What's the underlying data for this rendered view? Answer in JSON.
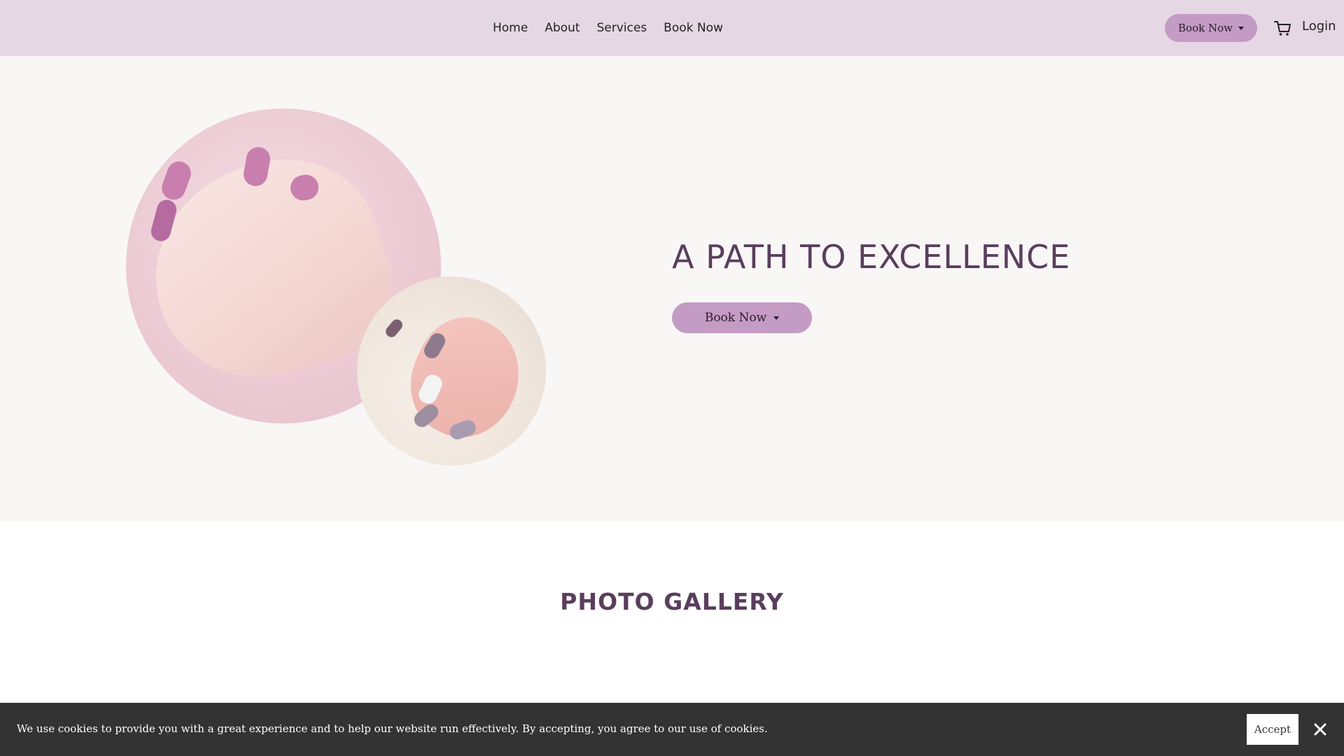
{
  "nav": {
    "items": [
      {
        "label": "Home"
      },
      {
        "label": "About"
      },
      {
        "label": "Services"
      },
      {
        "label": "Book Now"
      }
    ]
  },
  "header": {
    "book_button_label": "Book Now",
    "cart_icon": "cart-icon",
    "login_label": "Login"
  },
  "hero": {
    "title": "A PATH TO EXCELLENCE",
    "book_button_label": "Book Now"
  },
  "gallery": {
    "title": "PHOTO GALLERY"
  },
  "cookie_bar": {
    "message": "We use cookies to provide you with a great experience and to help our website run effectively. By accepting, you agree to our use of cookies.",
    "accept_label": "Accept",
    "close_icon": "close-icon"
  },
  "colors": {
    "header_bg": "#e6d7e4",
    "accent": "#c49bc4",
    "heading": "#5a3e5d",
    "hero_bg": "#f8f7f6",
    "cookie_bg": "#333333"
  }
}
